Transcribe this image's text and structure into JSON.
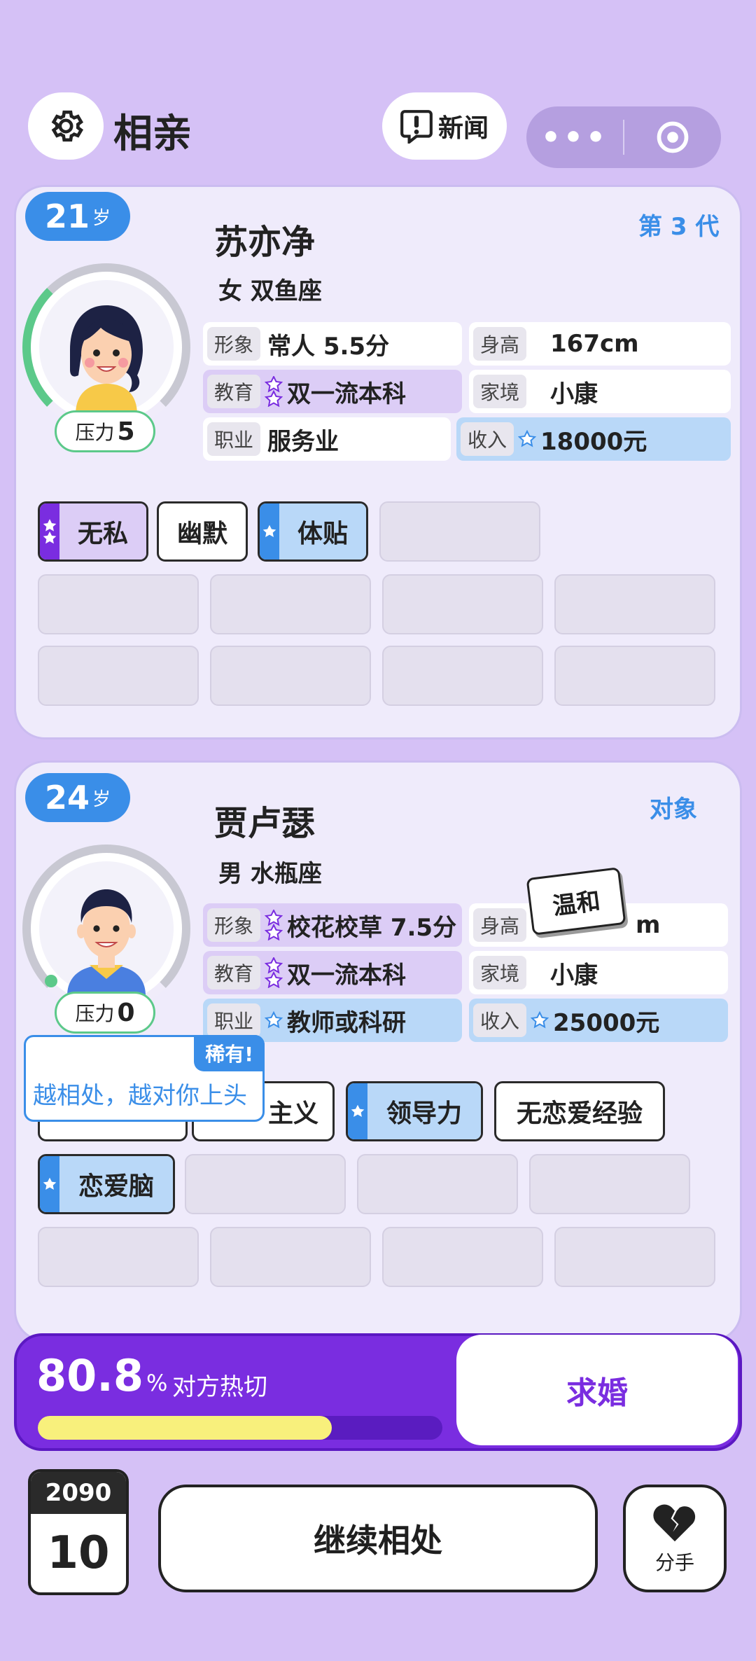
{
  "header": {
    "title": "相亲",
    "news_label": "新闻",
    "menu_dots": "•••"
  },
  "player": {
    "age": "21",
    "age_unit": "岁",
    "generation": "第 3 代",
    "name": "苏亦净",
    "gender_sign": "女 双鱼座",
    "pressure_label": "压力",
    "pressure": "5",
    "stats": [
      {
        "label": "形象",
        "value": "常人 5.5分"
      },
      {
        "label": "身高",
        "value": "167cm"
      },
      {
        "label": "教育",
        "value": "双一流本科"
      },
      {
        "label": "家境",
        "value": "小康"
      },
      {
        "label": "职业",
        "value": "服务业"
      },
      {
        "label": "收入",
        "value": "18000元"
      }
    ],
    "tags": [
      "无私",
      "幽默",
      "体贴"
    ]
  },
  "partner": {
    "age": "24",
    "age_unit": "岁",
    "role": "对象",
    "name": "贾卢瑟",
    "gender_sign": "男 水瓶座",
    "pressure_label": "压力",
    "pressure": "0",
    "stats": [
      {
        "label": "形象",
        "value": "校花校草 7.5分"
      },
      {
        "label": "身高",
        "value": "m"
      },
      {
        "label": "教育",
        "value": "双一流本科"
      },
      {
        "label": "家境",
        "value": "小康"
      },
      {
        "label": "职业",
        "value": "教师或科研"
      },
      {
        "label": "收入",
        "value": "25000元"
      }
    ],
    "tags": [
      "主义",
      "领导力",
      "无恋爱经验",
      "恋爱脑"
    ],
    "floating_tag": "温和",
    "tooltip": {
      "badge": "稀有!",
      "text": "越相处，越对你上头"
    }
  },
  "affinity": {
    "value": "80.8",
    "unit": "%",
    "label": "对方热切",
    "progress": 0.808
  },
  "actions": {
    "propose": "求婚",
    "continue": "继续相处",
    "breakup": "分手"
  },
  "calendar": {
    "year": "2090",
    "day": "10"
  },
  "colors": {
    "purple": "#7a2de0",
    "blue": "#3a8ee8",
    "bg": "#d5c1f6",
    "bar": "#f8f07c"
  }
}
